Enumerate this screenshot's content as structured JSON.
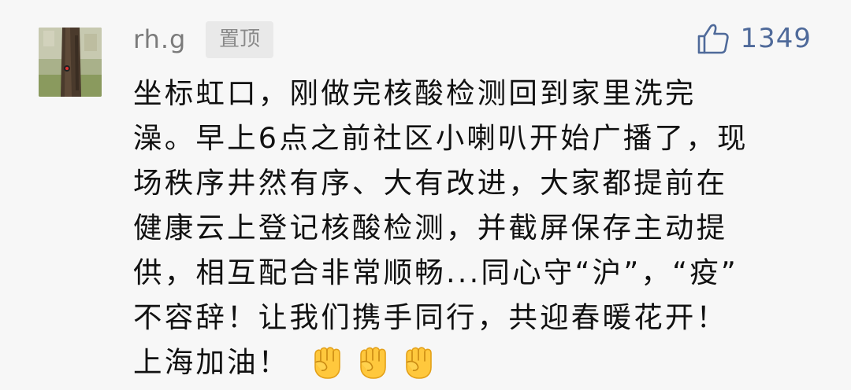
{
  "comment": {
    "username": "rh.g",
    "pin_label": "置顶",
    "like_icon": "thumbs-up-icon",
    "like_count": "1349",
    "lines": [
      "坐标虹口，刚做完核酸检测回到家里洗完",
      "澡。早上6点之前社区小喇叭开始广播了，现",
      "场秩序井然有序、大有改进，大家都提前在",
      "健康云上登记核酸检测，并截屏保存主动提",
      "供，相互配合非常顺畅...同心守“沪”，“疫”",
      "不容辞！让我们携手同行，共迎春暖花开！",
      "上海加油！"
    ],
    "emoji_icons": [
      "raised-fist-emoji",
      "raised-fist-emoji",
      "raised-fist-emoji"
    ],
    "colors": {
      "background": "#f7f7f7",
      "username": "#7b7b7b",
      "like_accent": "#4f6a9a",
      "body_text": "#111111",
      "pin_badge_bg": "#e9e9e9"
    }
  }
}
